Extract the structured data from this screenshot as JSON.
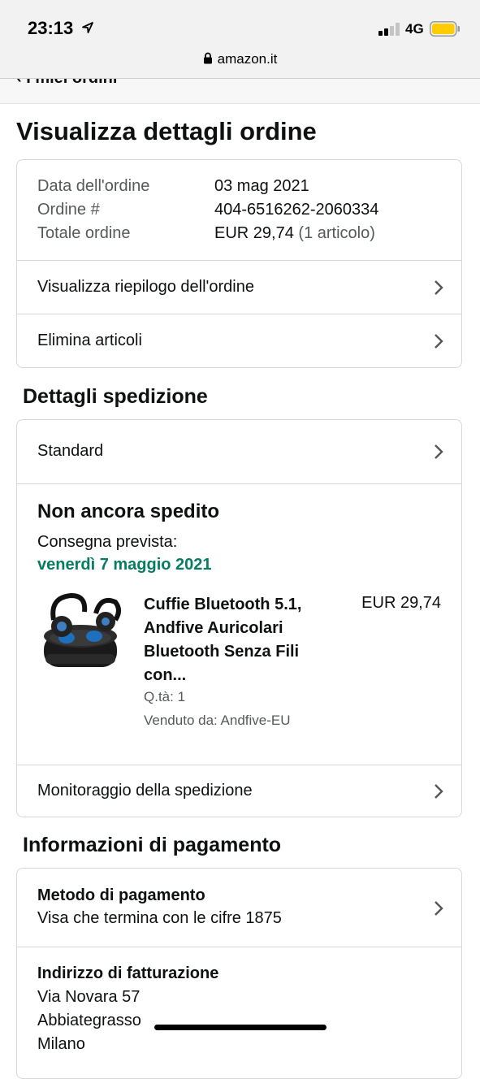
{
  "status_bar": {
    "time": "23:13",
    "network": "4G",
    "battery_color": "#ffcc00",
    "url": "amazon.it"
  },
  "back_link": {
    "label": "I miei ordini"
  },
  "page": {
    "title": "Visualizza dettagli ordine"
  },
  "order_summary": {
    "date_label": "Data dell'ordine",
    "date_value": "03 mag 2021",
    "number_label": "Ordine #",
    "number_value": "404-6516262-2060334",
    "total_label": "Totale ordine",
    "total_value": "EUR 29,74",
    "total_items": "(1 articolo)"
  },
  "order_links": {
    "summary": "Visualizza riepilogo dell'ordine",
    "delete": "Elimina articoli"
  },
  "shipping": {
    "heading": "Dettagli spedizione",
    "method": "Standard",
    "status": "Non ancora spedito",
    "delivery_label": "Consegna prevista:",
    "delivery_date": "venerdì 7 maggio 2021",
    "delivery_color": "#067d62",
    "item": {
      "title_lines": [
        "Cuffie Bluetooth 5.1,",
        "Andfive Auricolari",
        "Bluetooth Senza Fili",
        "con..."
      ],
      "price": "EUR 29,74",
      "qty": "Q.tà: 1",
      "seller": "Venduto da: Andfive-EU"
    },
    "tracking": "Monitoraggio della spedizione"
  },
  "payment": {
    "heading": "Informazioni di pagamento",
    "method_label": "Metodo di pagamento",
    "method_value": "Visa che termina con le cifre 1875",
    "billing_label": "Indirizzo di fatturazione",
    "billing_lines": [
      "Via Novara 57",
      "Abbiategrasso",
      "Milano"
    ]
  }
}
